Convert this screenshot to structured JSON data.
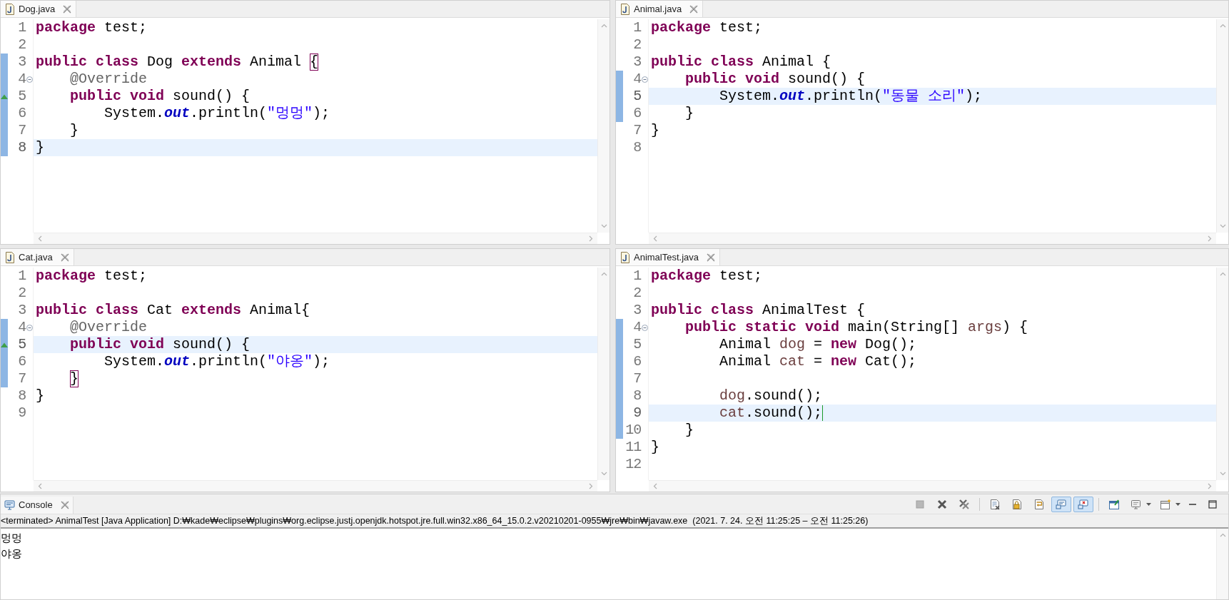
{
  "editors": [
    {
      "tab": {
        "title": "Dog.java"
      },
      "focused": false,
      "lines": [
        {
          "number": "1",
          "kind": "plain",
          "current": false,
          "changed": false,
          "tokens": [
            {
              "text": "package",
              "kind": "keyword"
            },
            {
              "text": " test;",
              "kind": "plain"
            }
          ]
        },
        {
          "number": "2",
          "kind": "plain",
          "current": false,
          "changed": false
        },
        {
          "number": "3",
          "kind": "plain",
          "current": false,
          "changed": true,
          "tokens": [
            {
              "text": "public class",
              "kind": "keyword"
            },
            {
              "text": " Dog ",
              "kind": "plain"
            },
            {
              "text": "extends",
              "kind": "keyword"
            },
            {
              "text": " Animal ",
              "kind": "plain"
            },
            {
              "text": "{",
              "kind": "match"
            }
          ]
        },
        {
          "number": "4",
          "kind": "fold",
          "current": false,
          "changed": true,
          "tokens": [
            {
              "text": "    @Override",
              "kind": "annotation"
            }
          ]
        },
        {
          "number": "5",
          "kind": "override",
          "current": false,
          "changed": true,
          "tokens": [
            {
              "text": "    public void",
              "kind": "keyword"
            },
            {
              "text": " sound() {",
              "kind": "plain"
            }
          ]
        },
        {
          "number": "6",
          "kind": "plain",
          "current": false,
          "changed": true,
          "tokens": [
            {
              "text": "        System.",
              "kind": "plain"
            },
            {
              "text": "out",
              "kind": "field"
            },
            {
              "text": ".println(",
              "kind": "plain"
            },
            {
              "text": "\"멍멍\"",
              "kind": "string"
            },
            {
              "text": ");",
              "kind": "plain"
            }
          ]
        },
        {
          "number": "7",
          "kind": "plain",
          "current": false,
          "changed": true,
          "tokens": [
            {
              "text": "    }",
              "kind": "plain"
            }
          ]
        },
        {
          "number": "8",
          "kind": "plain",
          "current": true,
          "changed": true,
          "tokens": [
            {
              "text": "}",
              "kind": "plain"
            }
          ]
        }
      ]
    },
    {
      "tab": {
        "title": "Animal.java"
      },
      "focused": false,
      "lines": [
        {
          "number": "1",
          "kind": "plain",
          "current": false,
          "changed": false,
          "tokens": [
            {
              "text": "package",
              "kind": "keyword"
            },
            {
              "text": " test;",
              "kind": "plain"
            }
          ]
        },
        {
          "number": "2",
          "kind": "plain",
          "current": false,
          "changed": false
        },
        {
          "number": "3",
          "kind": "plain",
          "current": false,
          "changed": false,
          "tokens": [
            {
              "text": "public class",
              "kind": "keyword"
            },
            {
              "text": " Animal {",
              "kind": "plain"
            }
          ]
        },
        {
          "number": "4",
          "kind": "fold",
          "current": false,
          "changed": true,
          "tokens": [
            {
              "text": "    public void",
              "kind": "keyword"
            },
            {
              "text": " sound() {",
              "kind": "plain"
            }
          ]
        },
        {
          "number": "5",
          "kind": "plain",
          "current": true,
          "changed": true,
          "tokens": [
            {
              "text": "        System.",
              "kind": "plain"
            },
            {
              "text": "out",
              "kind": "field"
            },
            {
              "text": ".println(",
              "kind": "plain"
            },
            {
              "text": "\"동물 소리\"",
              "kind": "string"
            },
            {
              "text": ");",
              "kind": "plain"
            }
          ]
        },
        {
          "number": "6",
          "kind": "plain",
          "current": false,
          "changed": true,
          "tokens": [
            {
              "text": "    }",
              "kind": "plain"
            }
          ]
        },
        {
          "number": "7",
          "kind": "plain",
          "current": false,
          "changed": false,
          "tokens": [
            {
              "text": "}",
              "kind": "plain"
            }
          ]
        },
        {
          "number": "8",
          "kind": "plain",
          "current": false,
          "changed": false
        }
      ]
    },
    {
      "tab": {
        "title": "Cat.java"
      },
      "focused": false,
      "lines": [
        {
          "number": "1",
          "kind": "plain",
          "current": false,
          "changed": false,
          "tokens": [
            {
              "text": "package",
              "kind": "keyword"
            },
            {
              "text": " test;",
              "kind": "plain"
            }
          ]
        },
        {
          "number": "2",
          "kind": "plain",
          "current": false,
          "changed": false
        },
        {
          "number": "3",
          "kind": "plain",
          "current": false,
          "changed": false,
          "tokens": [
            {
              "text": "public class",
              "kind": "keyword"
            },
            {
              "text": " Cat ",
              "kind": "plain"
            },
            {
              "text": "extends",
              "kind": "keyword"
            },
            {
              "text": " Animal{",
              "kind": "plain"
            }
          ]
        },
        {
          "number": "4",
          "kind": "fold",
          "current": false,
          "changed": true,
          "tokens": [
            {
              "text": "    @Override",
              "kind": "annotation"
            }
          ]
        },
        {
          "number": "5",
          "kind": "override",
          "current": true,
          "changed": true,
          "tokens": [
            {
              "text": "    public void",
              "kind": "keyword"
            },
            {
              "text": " sound() {",
              "kind": "plain"
            }
          ]
        },
        {
          "number": "6",
          "kind": "plain",
          "current": false,
          "changed": true,
          "tokens": [
            {
              "text": "        System.",
              "kind": "plain"
            },
            {
              "text": "out",
              "kind": "field"
            },
            {
              "text": ".println(",
              "kind": "plain"
            },
            {
              "text": "\"야옹\"",
              "kind": "string"
            },
            {
              "text": ");",
              "kind": "plain"
            }
          ]
        },
        {
          "number": "7",
          "kind": "plain",
          "current": false,
          "changed": true,
          "tokens": [
            {
              "text": "    }",
              "kind": "match"
            }
          ]
        },
        {
          "number": "8",
          "kind": "plain",
          "current": false,
          "changed": false,
          "tokens": [
            {
              "text": "}",
              "kind": "plain"
            }
          ]
        },
        {
          "number": "9",
          "kind": "plain",
          "current": false,
          "changed": false
        }
      ]
    },
    {
      "tab": {
        "title": "AnimalTest.java"
      },
      "focused": true,
      "lines": [
        {
          "number": "1",
          "kind": "plain",
          "current": false,
          "changed": false,
          "tokens": [
            {
              "text": "package",
              "kind": "keyword"
            },
            {
              "text": " test;",
              "kind": "plain"
            }
          ]
        },
        {
          "number": "2",
          "kind": "plain",
          "current": false,
          "changed": false
        },
        {
          "number": "3",
          "kind": "plain",
          "current": false,
          "changed": false,
          "tokens": [
            {
              "text": "public class",
              "kind": "keyword"
            },
            {
              "text": " AnimalTest {",
              "kind": "plain"
            }
          ]
        },
        {
          "number": "4",
          "kind": "fold",
          "current": false,
          "changed": true,
          "tokens": [
            {
              "text": "    public static void",
              "kind": "keyword"
            },
            {
              "text": " main(String[] ",
              "kind": "plain"
            },
            {
              "text": "args",
              "kind": "local"
            },
            {
              "text": ") {",
              "kind": "plain"
            }
          ]
        },
        {
          "number": "5",
          "kind": "plain",
          "current": false,
          "changed": true,
          "tokens": [
            {
              "text": "        Animal ",
              "kind": "plain"
            },
            {
              "text": "dog",
              "kind": "local"
            },
            {
              "text": " = ",
              "kind": "plain"
            },
            {
              "text": "new",
              "kind": "keyword"
            },
            {
              "text": " Dog();",
              "kind": "plain"
            }
          ]
        },
        {
          "number": "6",
          "kind": "plain",
          "current": false,
          "changed": true,
          "tokens": [
            {
              "text": "        Animal ",
              "kind": "plain"
            },
            {
              "text": "cat",
              "kind": "local"
            },
            {
              "text": " = ",
              "kind": "plain"
            },
            {
              "text": "new",
              "kind": "keyword"
            },
            {
              "text": " Cat();",
              "kind": "plain"
            }
          ]
        },
        {
          "number": "7",
          "kind": "plain",
          "current": false,
          "changed": true
        },
        {
          "number": "8",
          "kind": "plain",
          "current": false,
          "changed": true,
          "tokens": [
            {
              "text": "        dog",
              "kind": "local"
            },
            {
              "text": ".sound();",
              "kind": "plain"
            }
          ]
        },
        {
          "number": "9",
          "kind": "plain",
          "current": true,
          "changed": true,
          "tokens": [
            {
              "text": "        cat",
              "kind": "local"
            },
            {
              "text": ".sound();",
              "kind": "plain"
            }
          ]
        },
        {
          "number": "10",
          "kind": "plain",
          "current": false,
          "changed": true,
          "tokens": [
            {
              "text": "    }",
              "kind": "plain"
            }
          ]
        },
        {
          "number": "11",
          "kind": "plain",
          "current": false,
          "changed": false,
          "tokens": [
            {
              "text": "}",
              "kind": "plain"
            }
          ]
        },
        {
          "number": "12",
          "kind": "plain",
          "current": false,
          "changed": false
        }
      ]
    }
  ],
  "console": {
    "tab": {
      "title": "Console"
    },
    "toolbar": [
      {
        "kind": "stop",
        "on": false
      },
      {
        "kind": "remove",
        "on": false
      },
      {
        "kind": "remove-all",
        "on": false
      },
      {
        "kind": "separator"
      },
      {
        "kind": "clear",
        "on": false
      },
      {
        "kind": "scroll-lock",
        "on": false
      },
      {
        "kind": "word-wrap",
        "on": false
      },
      {
        "kind": "show-stdout",
        "on": true
      },
      {
        "kind": "show-stderr",
        "on": true
      },
      {
        "kind": "separator"
      },
      {
        "kind": "pin",
        "on": false
      },
      {
        "kind": "display",
        "on": false
      },
      {
        "kind": "new-console",
        "on": false
      },
      {
        "kind": "minimize",
        "on": false
      },
      {
        "kind": "maximize",
        "on": false
      }
    ],
    "description": "<terminated> AnimalTest [Java Application] D:₩kade₩eclipse₩plugins₩org.eclipse.justj.openjdk.hotspot.jre.full.win32.x86_64_15.0.2.v20210201-0955₩jre₩bin₩javaw.exe  (2021. 7. 24. 오전 11:25:25 – 오전 11:25:26)",
    "output": [
      "멍멍",
      "야옹"
    ]
  }
}
